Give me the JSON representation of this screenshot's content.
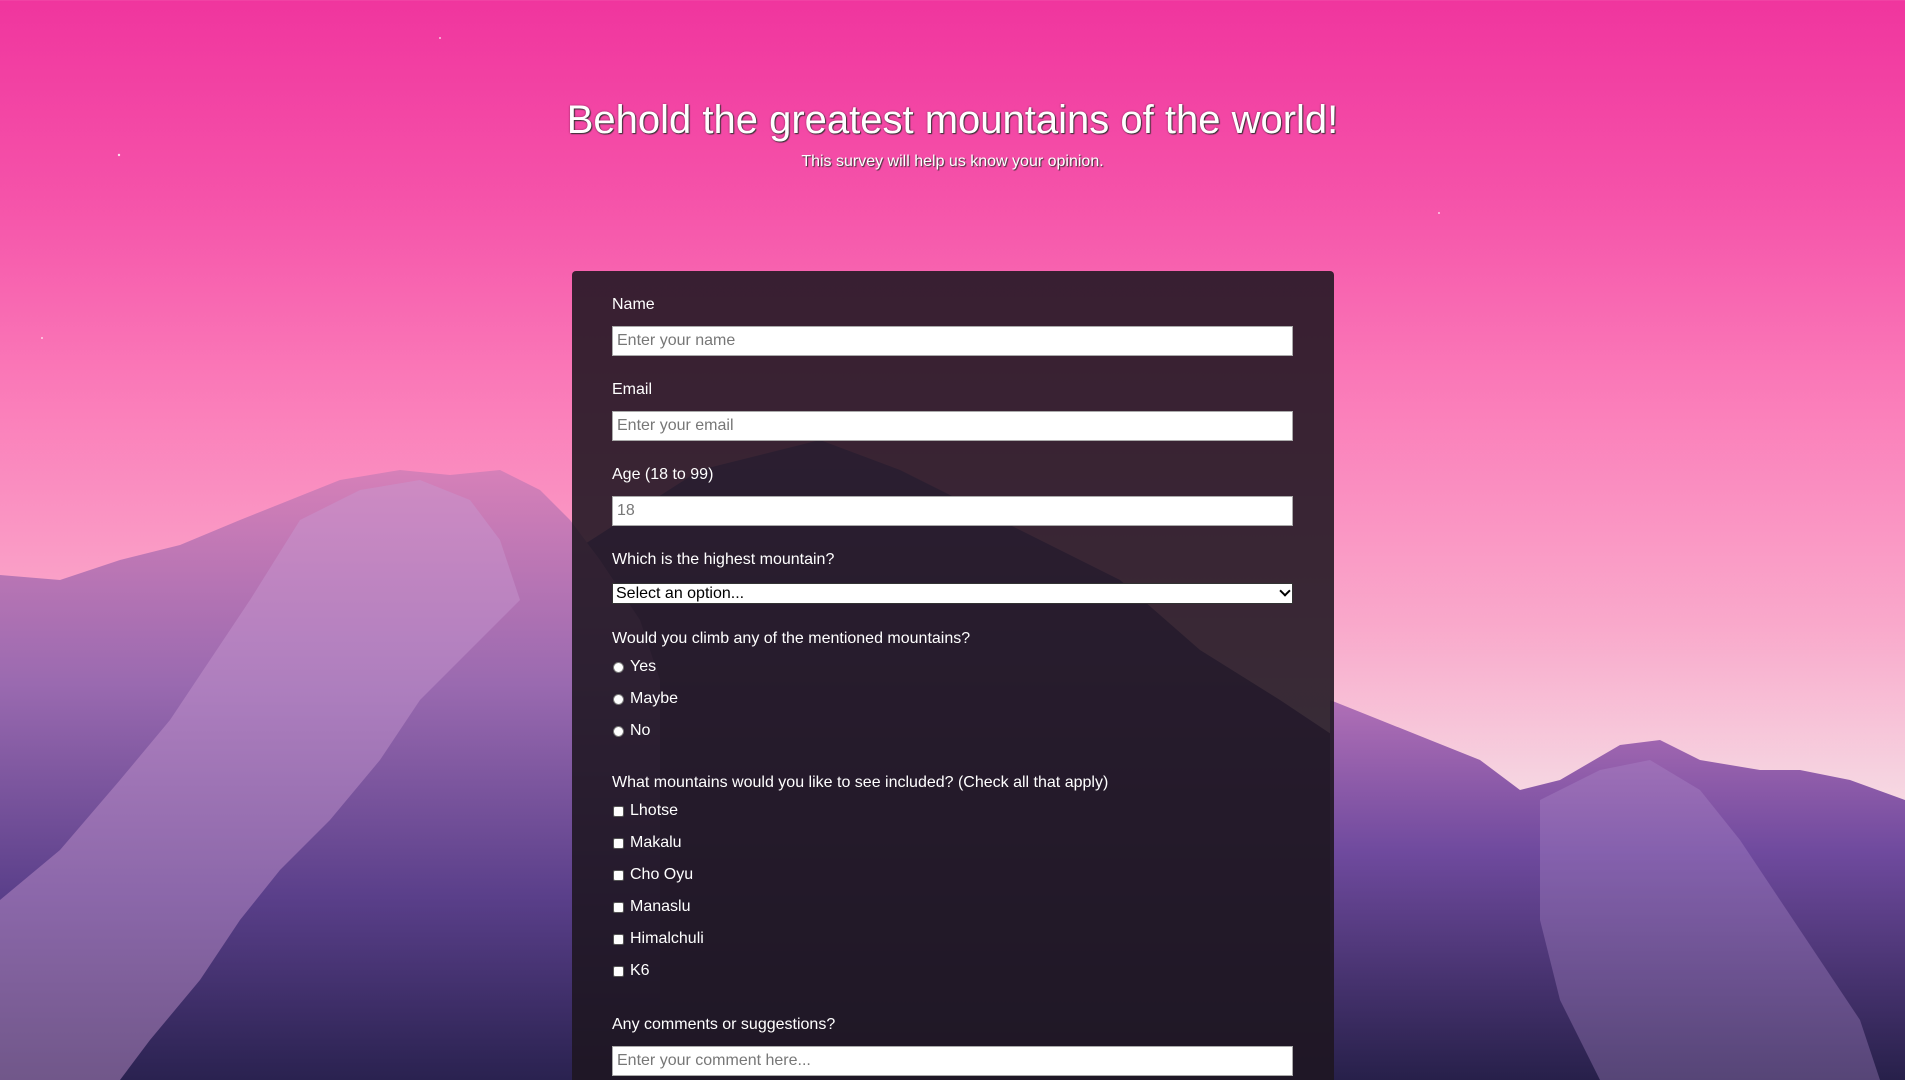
{
  "header": {
    "title": "Behold the greatest mountains of the world!",
    "subtitle": "This survey will help us know your opinion."
  },
  "form": {
    "name": {
      "label": "Name",
      "placeholder": "Enter your name"
    },
    "email": {
      "label": "Email",
      "placeholder": "Enter your email"
    },
    "age": {
      "label": "Age (18 to 99)",
      "placeholder": "18"
    },
    "highest_mountain": {
      "label": "Which is the highest mountain?",
      "selected": "Select an option..."
    },
    "climb": {
      "label": "Would you climb any of the mentioned mountains?",
      "options": [
        "Yes",
        "Maybe",
        "No"
      ]
    },
    "include": {
      "label": "What mountains would you like to see included? (Check all that apply)",
      "options": [
        "Lhotse",
        "Makalu",
        "Cho Oyu",
        "Manaslu",
        "Himalchuli",
        "K6"
      ]
    },
    "comments": {
      "label": "Any comments or suggestions?",
      "placeholder": "Enter your comment here..."
    }
  },
  "colors": {
    "sky_top": "#f0359e",
    "card_background": "#1e1620",
    "mountain_purple": "#7a4fa0"
  }
}
